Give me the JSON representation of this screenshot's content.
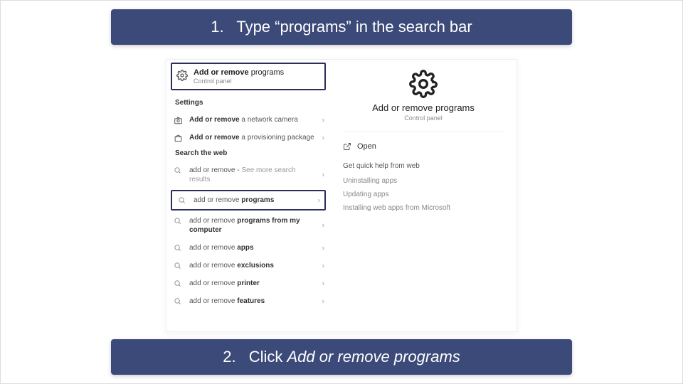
{
  "instructions": {
    "top_num": "1.",
    "top_text": "Type “programs” in the search bar",
    "bottom_num": "2.",
    "bottom_prefix": "Click ",
    "bottom_em": "Add or remove programs"
  },
  "top_result": {
    "title_bold": "Add or remove",
    "title_rest": " programs",
    "sub": "Control panel"
  },
  "sections": {
    "settings": "Settings",
    "web": "Search the web"
  },
  "settings_items": [
    {
      "bold": "Add or remove",
      "rest": " a network camera",
      "icon": "camera"
    },
    {
      "bold": "Add or remove",
      "rest": " a provisioning package",
      "icon": "package"
    }
  ],
  "web_items": [
    {
      "pre": "add or remove",
      "bold": "",
      "post": " - ",
      "dim": "See more search results",
      "highlight": false
    },
    {
      "pre": "add or remove ",
      "bold": "programs",
      "post": "",
      "dim": "",
      "highlight": true
    },
    {
      "pre": "add or remove ",
      "bold": "programs from my computer",
      "post": "",
      "dim": "",
      "highlight": false
    },
    {
      "pre": "add or remove ",
      "bold": "apps",
      "post": "",
      "dim": "",
      "highlight": false
    },
    {
      "pre": "add or remove ",
      "bold": "exclusions",
      "post": "",
      "dim": "",
      "highlight": false
    },
    {
      "pre": "add or remove ",
      "bold": "printer",
      "post": "",
      "dim": "",
      "highlight": false
    },
    {
      "pre": "add or remove ",
      "bold": "features",
      "post": "",
      "dim": "",
      "highlight": false
    }
  ],
  "preview": {
    "title": "Add or remove programs",
    "sub": "Control panel",
    "open": "Open",
    "help_header": "Get quick help from web",
    "help_links": [
      "Uninstalling apps",
      "Updating apps",
      "Installing web apps from Microsoft"
    ]
  }
}
